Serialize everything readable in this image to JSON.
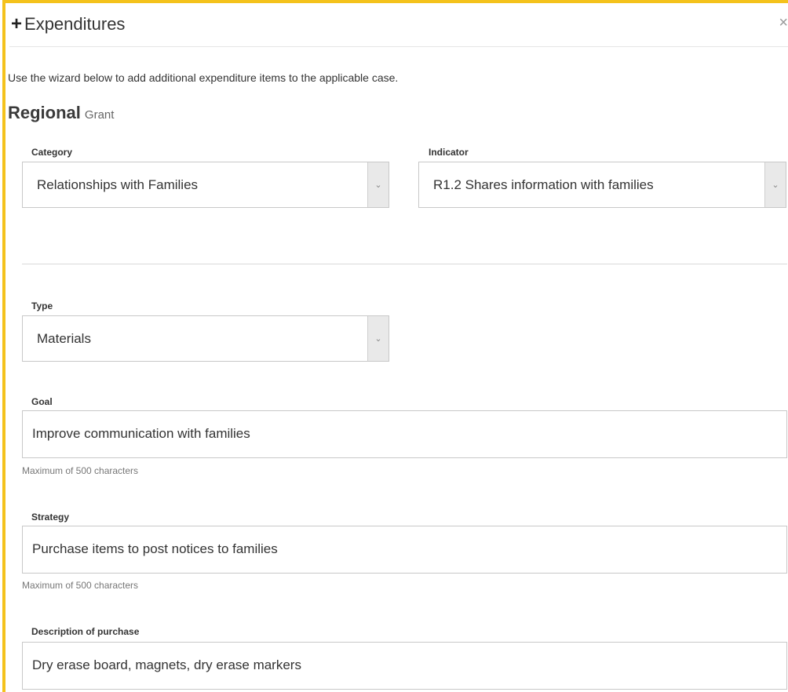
{
  "colors": {
    "accent": "#f4c21c"
  },
  "dialog": {
    "title": "Expenditures",
    "plus_icon": "+",
    "close_icon": "×",
    "intro": "Use the wizard below to add additional expenditure items to the applicable case.",
    "program_name": "Regional",
    "program_type": "Grant"
  },
  "form": {
    "category": {
      "label": "Category",
      "value": "Relationships with Families"
    },
    "indicator": {
      "label": "Indicator",
      "value": "R1.2 Shares information with families"
    },
    "type": {
      "label": "Type",
      "value": "Materials"
    },
    "goal": {
      "label": "Goal",
      "value": "Improve communication with families",
      "hint": "Maximum of 500 characters"
    },
    "strategy": {
      "label": "Strategy",
      "value": "Purchase items to post notices to families",
      "hint": "Maximum of 500 characters"
    },
    "description": {
      "label": "Description of purchase",
      "value": "Dry erase board, magnets, dry erase markers"
    },
    "dropdown_arrow": "⌄"
  }
}
